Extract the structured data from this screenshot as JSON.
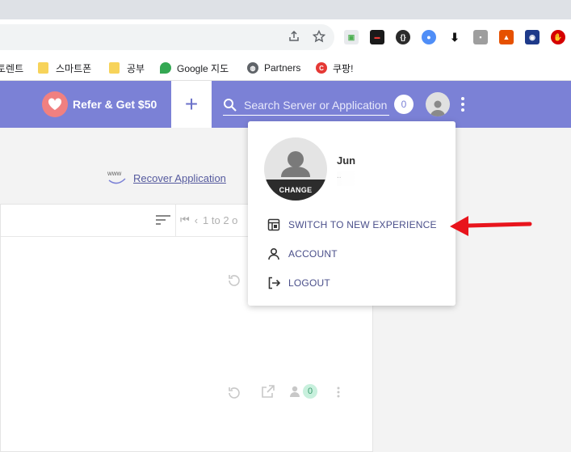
{
  "bookmarks": [
    {
      "label": "토렌트",
      "icon": "none"
    },
    {
      "label": "스마트폰",
      "icon": "folder-icon"
    },
    {
      "label": "공부",
      "icon": "folder-icon"
    },
    {
      "label": "Google 지도",
      "icon": "maps-pin-icon"
    },
    {
      "label": "Partners",
      "icon": "globe-icon"
    },
    {
      "label": "쿠팡!",
      "icon": "coupang-icon"
    }
  ],
  "header": {
    "refer_label": "Refer & Get $50",
    "search_placeholder": "Search Server or Application",
    "search_count": "0"
  },
  "content": {
    "recover_icon_text": "www",
    "recover_label": "Recover Application",
    "pager_text": "1 to 2 o",
    "collaborator_count": "0"
  },
  "dropdown": {
    "change_label": "CHANGE",
    "user_name": "Jun",
    "user_email": "..",
    "items": [
      {
        "label": "SWITCH TO NEW EXPERIENCE",
        "icon": "layout-icon"
      },
      {
        "label": "ACCOUNT",
        "icon": "person-icon"
      },
      {
        "label": "LOGOUT",
        "icon": "logout-icon"
      }
    ]
  },
  "colors": {
    "header_bg": "#7b81d6",
    "heart_bg": "#f08080",
    "menu_text": "#4a4f8a",
    "annotation_arrow": "#e8141c"
  }
}
